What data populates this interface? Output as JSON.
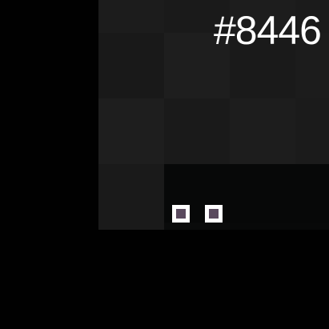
{
  "hud": {
    "score_label": "#8446"
  },
  "colors": {
    "background": "#010101",
    "board_base": "#222222",
    "tile_a": "#1b1b1b",
    "tile_b": "#1e1e1e",
    "tile_c": "#191919",
    "dark_strip": "#070808",
    "eye_white": "#ffffff",
    "pupil": "#5a4a5e",
    "text": "#ffffff"
  },
  "board": {
    "tiles": [
      [
        "#1c1c1c",
        "#1a1a1a",
        "#1d1d1d",
        "#1b1b1b"
      ],
      [
        "#191919",
        "#1e1e1e",
        "#1a1a1a",
        "#1c1c1c"
      ],
      [
        "#1e1e1e",
        "#1a1a1a",
        "#1d1d1d",
        "#1b1b1b"
      ],
      [
        "#1a1a1a",
        "#0a0b0b",
        "#080909",
        "#080909"
      ]
    ]
  },
  "player": {
    "icon": "creature-eyes-icon"
  }
}
